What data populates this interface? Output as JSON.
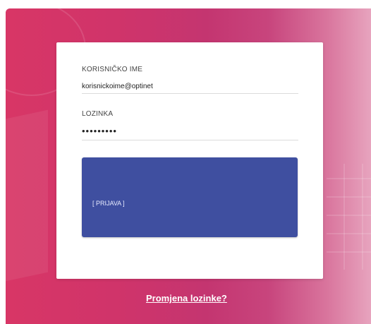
{
  "login": {
    "username_label": "KORISNIČKO IME",
    "username_value": "korisnickoime@optinet",
    "password_label": "LOZINKA",
    "password_masked": "•••••••••",
    "submit_label": "[ PRIJAVA ]"
  },
  "footer": {
    "change_password_link": "Promjena lozinke?"
  },
  "colors": {
    "background_gradient_start": "#d83666",
    "background_gradient_end": "#e7a4be",
    "button": "#3f4fa0",
    "card": "#ffffff"
  }
}
